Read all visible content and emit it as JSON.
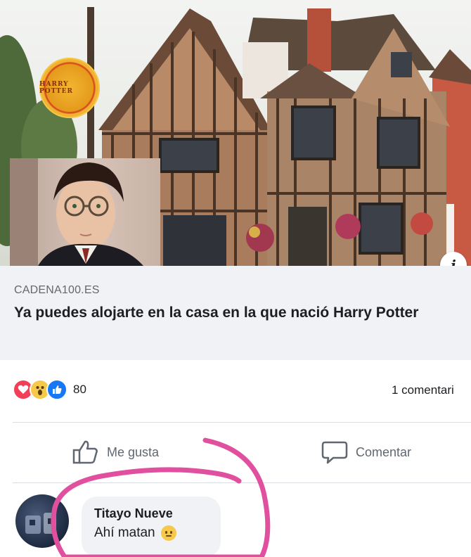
{
  "link_preview": {
    "badge_text": "HARRY POTTER",
    "info_icon": "i"
  },
  "link_caption": {
    "domain": "CADENA100.ES",
    "headline": "Ya puedes alojarte en la casa en la que nació Harry Potter"
  },
  "reactions": {
    "icons": [
      "love-reaction-icon",
      "wow-reaction-icon",
      "like-reaction-icon"
    ],
    "count": "80",
    "comments_count": "1 comentari"
  },
  "actions": {
    "like_label": "Me gusta",
    "comment_label": "Comentar"
  },
  "comment": {
    "author": "Titayo Nueve",
    "text": "Ahí matan"
  },
  "colors": {
    "caption_bg": "#f0f2f5",
    "love": "#f33e58",
    "wow": "#f7c94a",
    "like": "#1877f2",
    "circle_annotation": "#e0509e"
  }
}
